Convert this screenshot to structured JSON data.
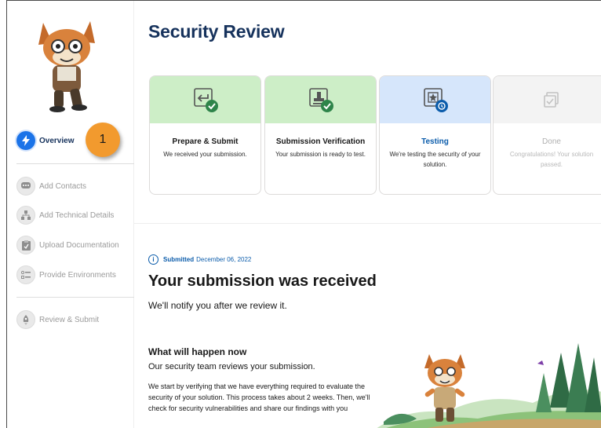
{
  "page": {
    "title": "Security Review"
  },
  "callout": {
    "number": "1"
  },
  "sidebar": {
    "items": [
      {
        "label": "Overview",
        "icon": "lightning-icon",
        "active": true
      },
      {
        "label": "Add Contacts",
        "icon": "chat-icon",
        "active": false
      },
      {
        "label": "Add Technical Details",
        "icon": "hierarchy-icon",
        "active": false
      },
      {
        "label": "Upload Documentation",
        "icon": "clipboard-icon",
        "active": false
      },
      {
        "label": "Provide Environments",
        "icon": "list-icon",
        "active": false
      },
      {
        "label": "Review & Submit",
        "icon": "rocket-icon",
        "active": false
      }
    ]
  },
  "steps": [
    {
      "title": "Prepare & Submit",
      "description": "We received your submission.",
      "status": "complete",
      "color": "#cdeec7"
    },
    {
      "title": "Submission Verification",
      "description": "Your submission is ready to test.",
      "status": "complete",
      "color": "#cdeec7"
    },
    {
      "title": "Testing",
      "description": "We're testing the security of your solution.",
      "status": "in-progress",
      "color": "#d6e6fb"
    },
    {
      "title": "Done",
      "description": "Congratulations! Your solution passed.",
      "status": "pending",
      "color": "#f3f3f3"
    }
  ],
  "submission": {
    "submitted_label": "Submitted",
    "submitted_date": "December 06, 2022",
    "title": "Your submission was received",
    "subtitle": "We'll notify you after we review it."
  },
  "what_happens": {
    "title": "What will happen now",
    "subtitle": "Our security team reviews your submission.",
    "body": "We start by verifying that we have everything required to evaluate the security of your solution. This process takes about 2 weeks. Then, we'll check for security vulnerabilities and share our findings with you"
  },
  "colors": {
    "brand_navy": "#16325c",
    "accent_blue": "#0b5cab",
    "complete_green": "#2e844a",
    "callout_orange": "#f29a2e"
  }
}
